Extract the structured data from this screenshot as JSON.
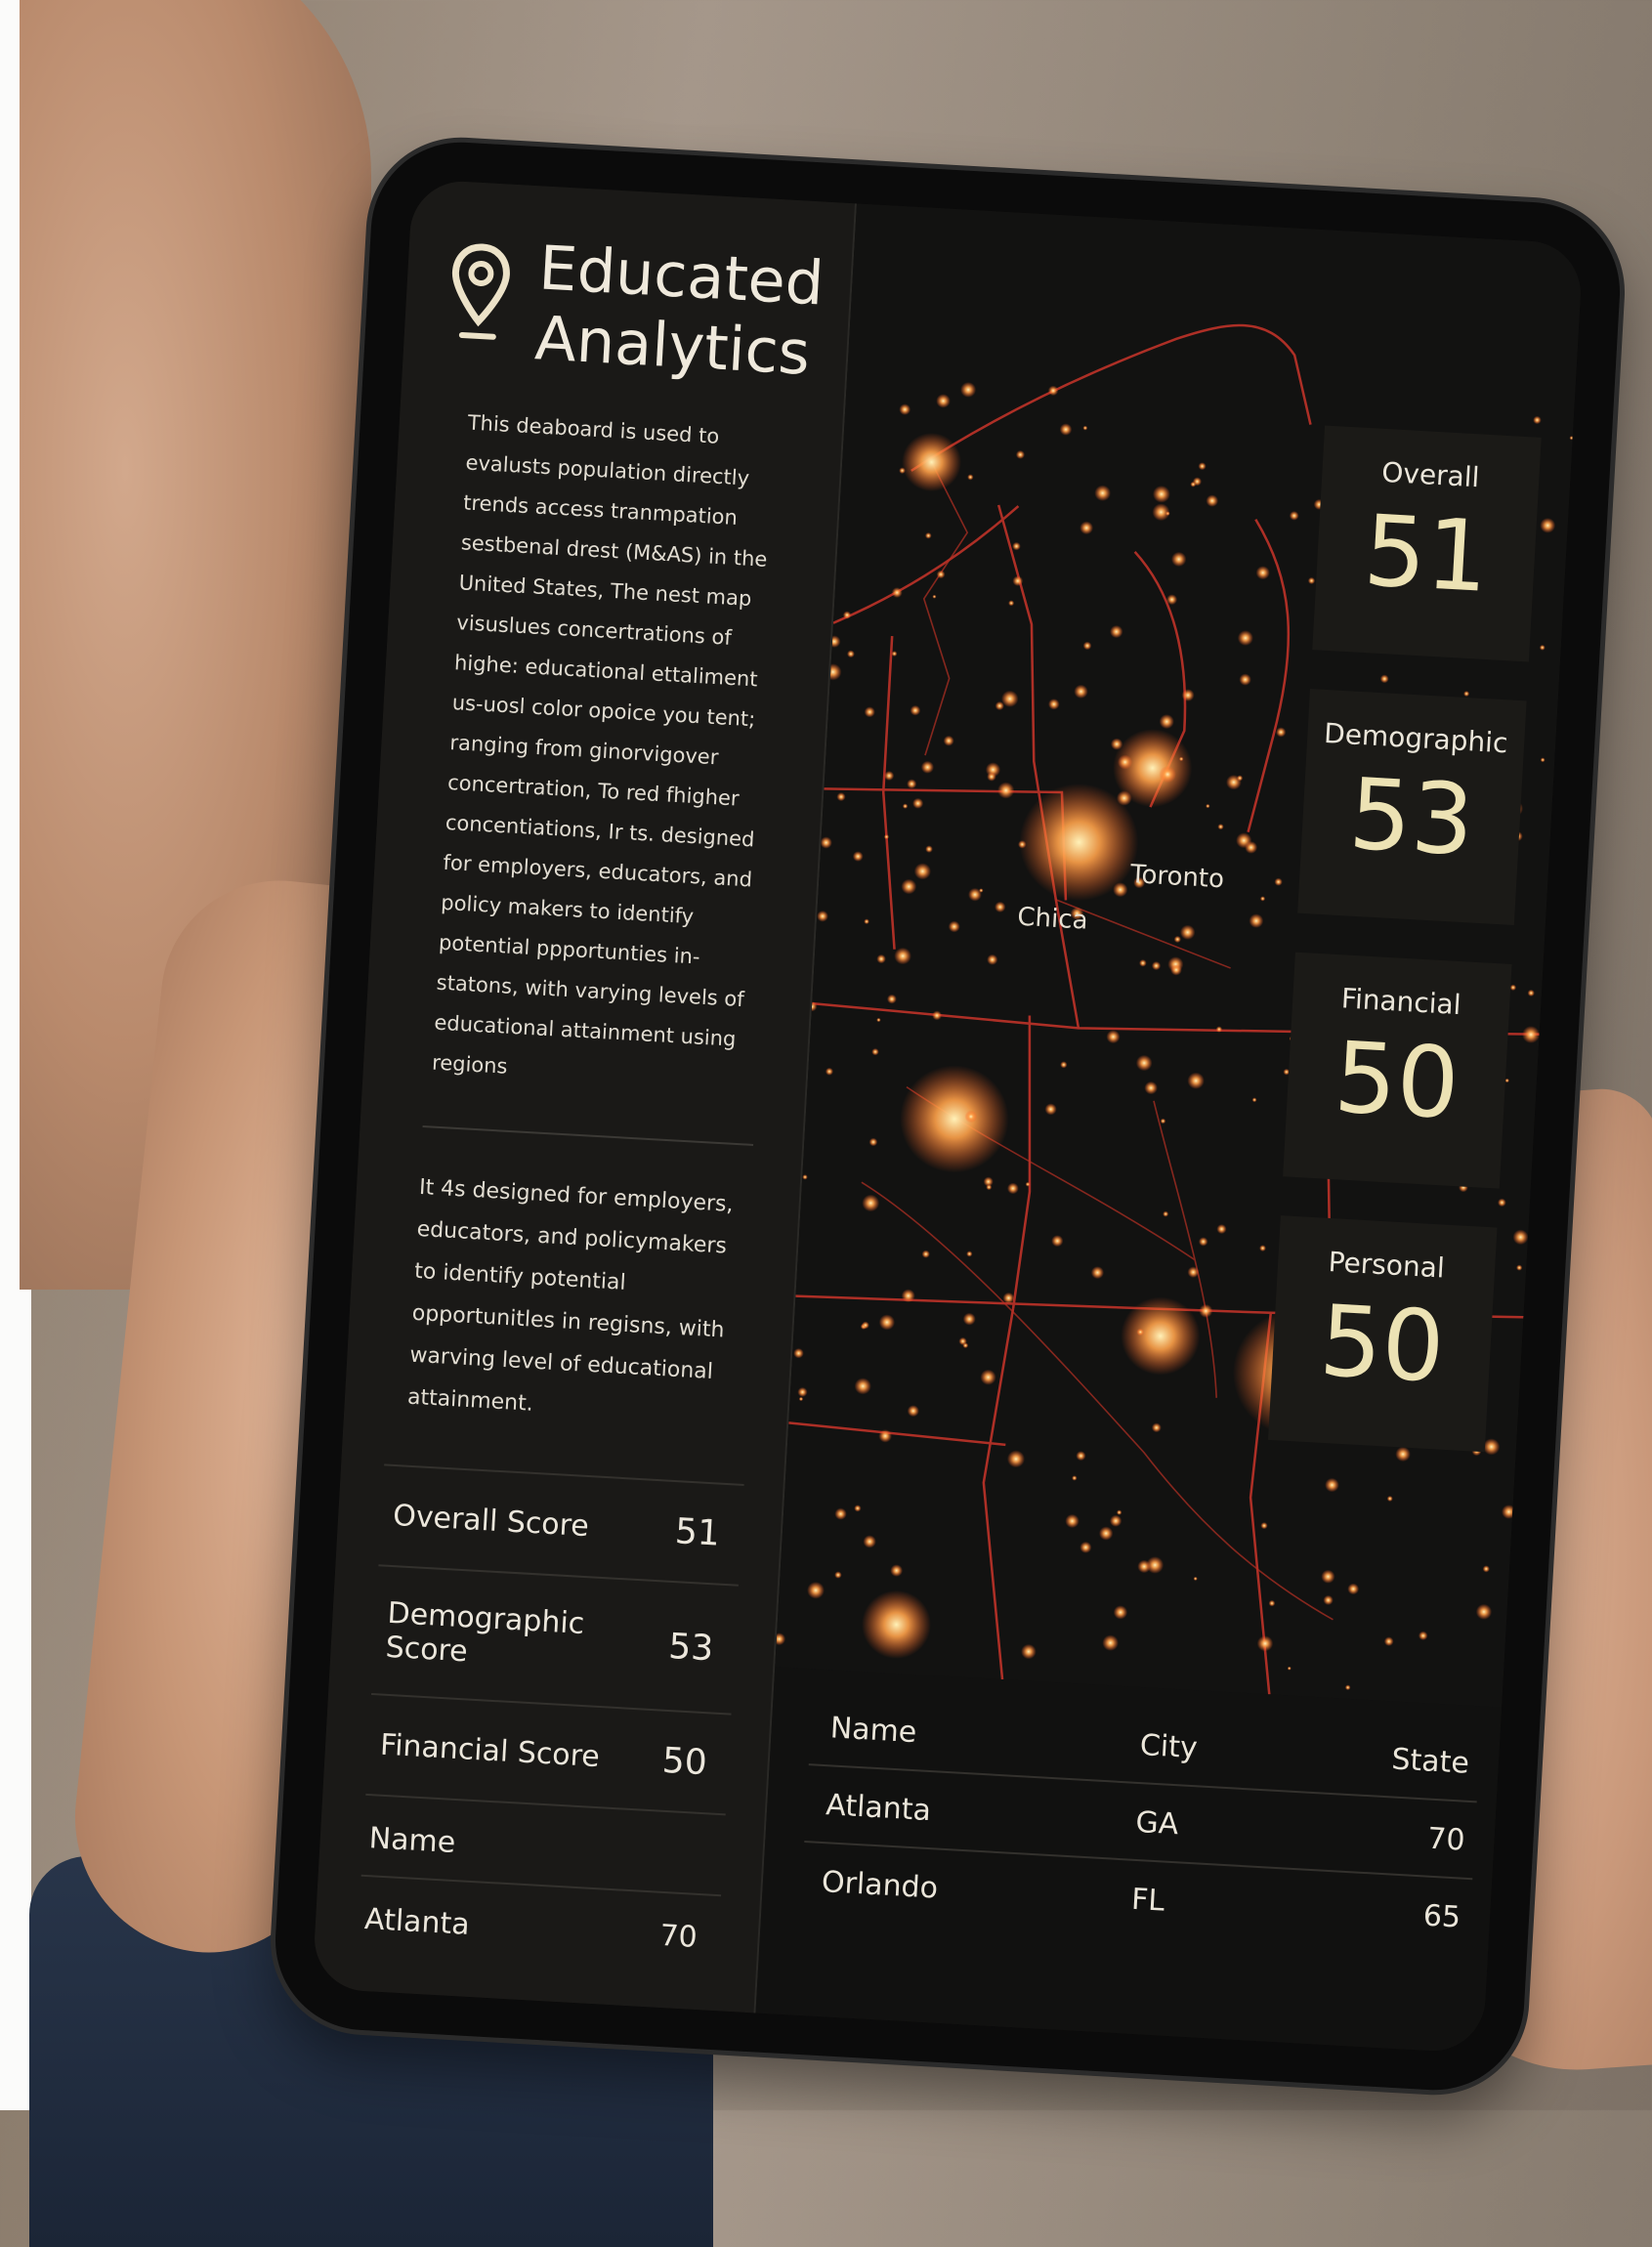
{
  "app": {
    "title_line1": "Educated",
    "title_line2": "Analytics",
    "accent_color": "#ece2b4",
    "map_glow_color": "#ff7a2a",
    "border_color": "#d43a2a"
  },
  "description": {
    "paragraph1": "This deaboard is used to evalusts population directly trends access tranmpation sestbenal drest (M&AS) in the United States, The nest map visuslues concertrations of highe: educational ettaliment us-uosl color opoice you tent; ranging from ginorvigover concertration, To red fhigher concentiations, Ir ts. designed for employers, educators, and policy makers to identify potential ppportunties in-statons, with varying levels of educational attainment using regions",
    "paragraph2": "It 4s designed for employers, educators, and policymakers to identify potential opportunitles in regisns, with warving level of educational attainment."
  },
  "scores": [
    {
      "label": "Overall Score",
      "value": "51"
    },
    {
      "label": "Demographic Score",
      "value": "53"
    },
    {
      "label": "Financial Score",
      "value": "50"
    }
  ],
  "left_table": {
    "header": "Name",
    "rows": [
      {
        "name": "Atlanta",
        "value": "70"
      }
    ]
  },
  "stat_cards": [
    {
      "label": "Overall",
      "value": "51"
    },
    {
      "label": "Demographic",
      "value": "53"
    },
    {
      "label": "Financial",
      "value": "50"
    },
    {
      "label": "Personal",
      "value": "50"
    }
  ],
  "map": {
    "city_labels": [
      "Toronto",
      "Chica"
    ]
  },
  "right_table": {
    "headers": [
      "Name",
      "City",
      "State"
    ],
    "rows": [
      {
        "name": "Atlanta",
        "city": "GA",
        "state": "70"
      },
      {
        "name": "Orlando",
        "city": "FL",
        "state": "65"
      }
    ]
  }
}
